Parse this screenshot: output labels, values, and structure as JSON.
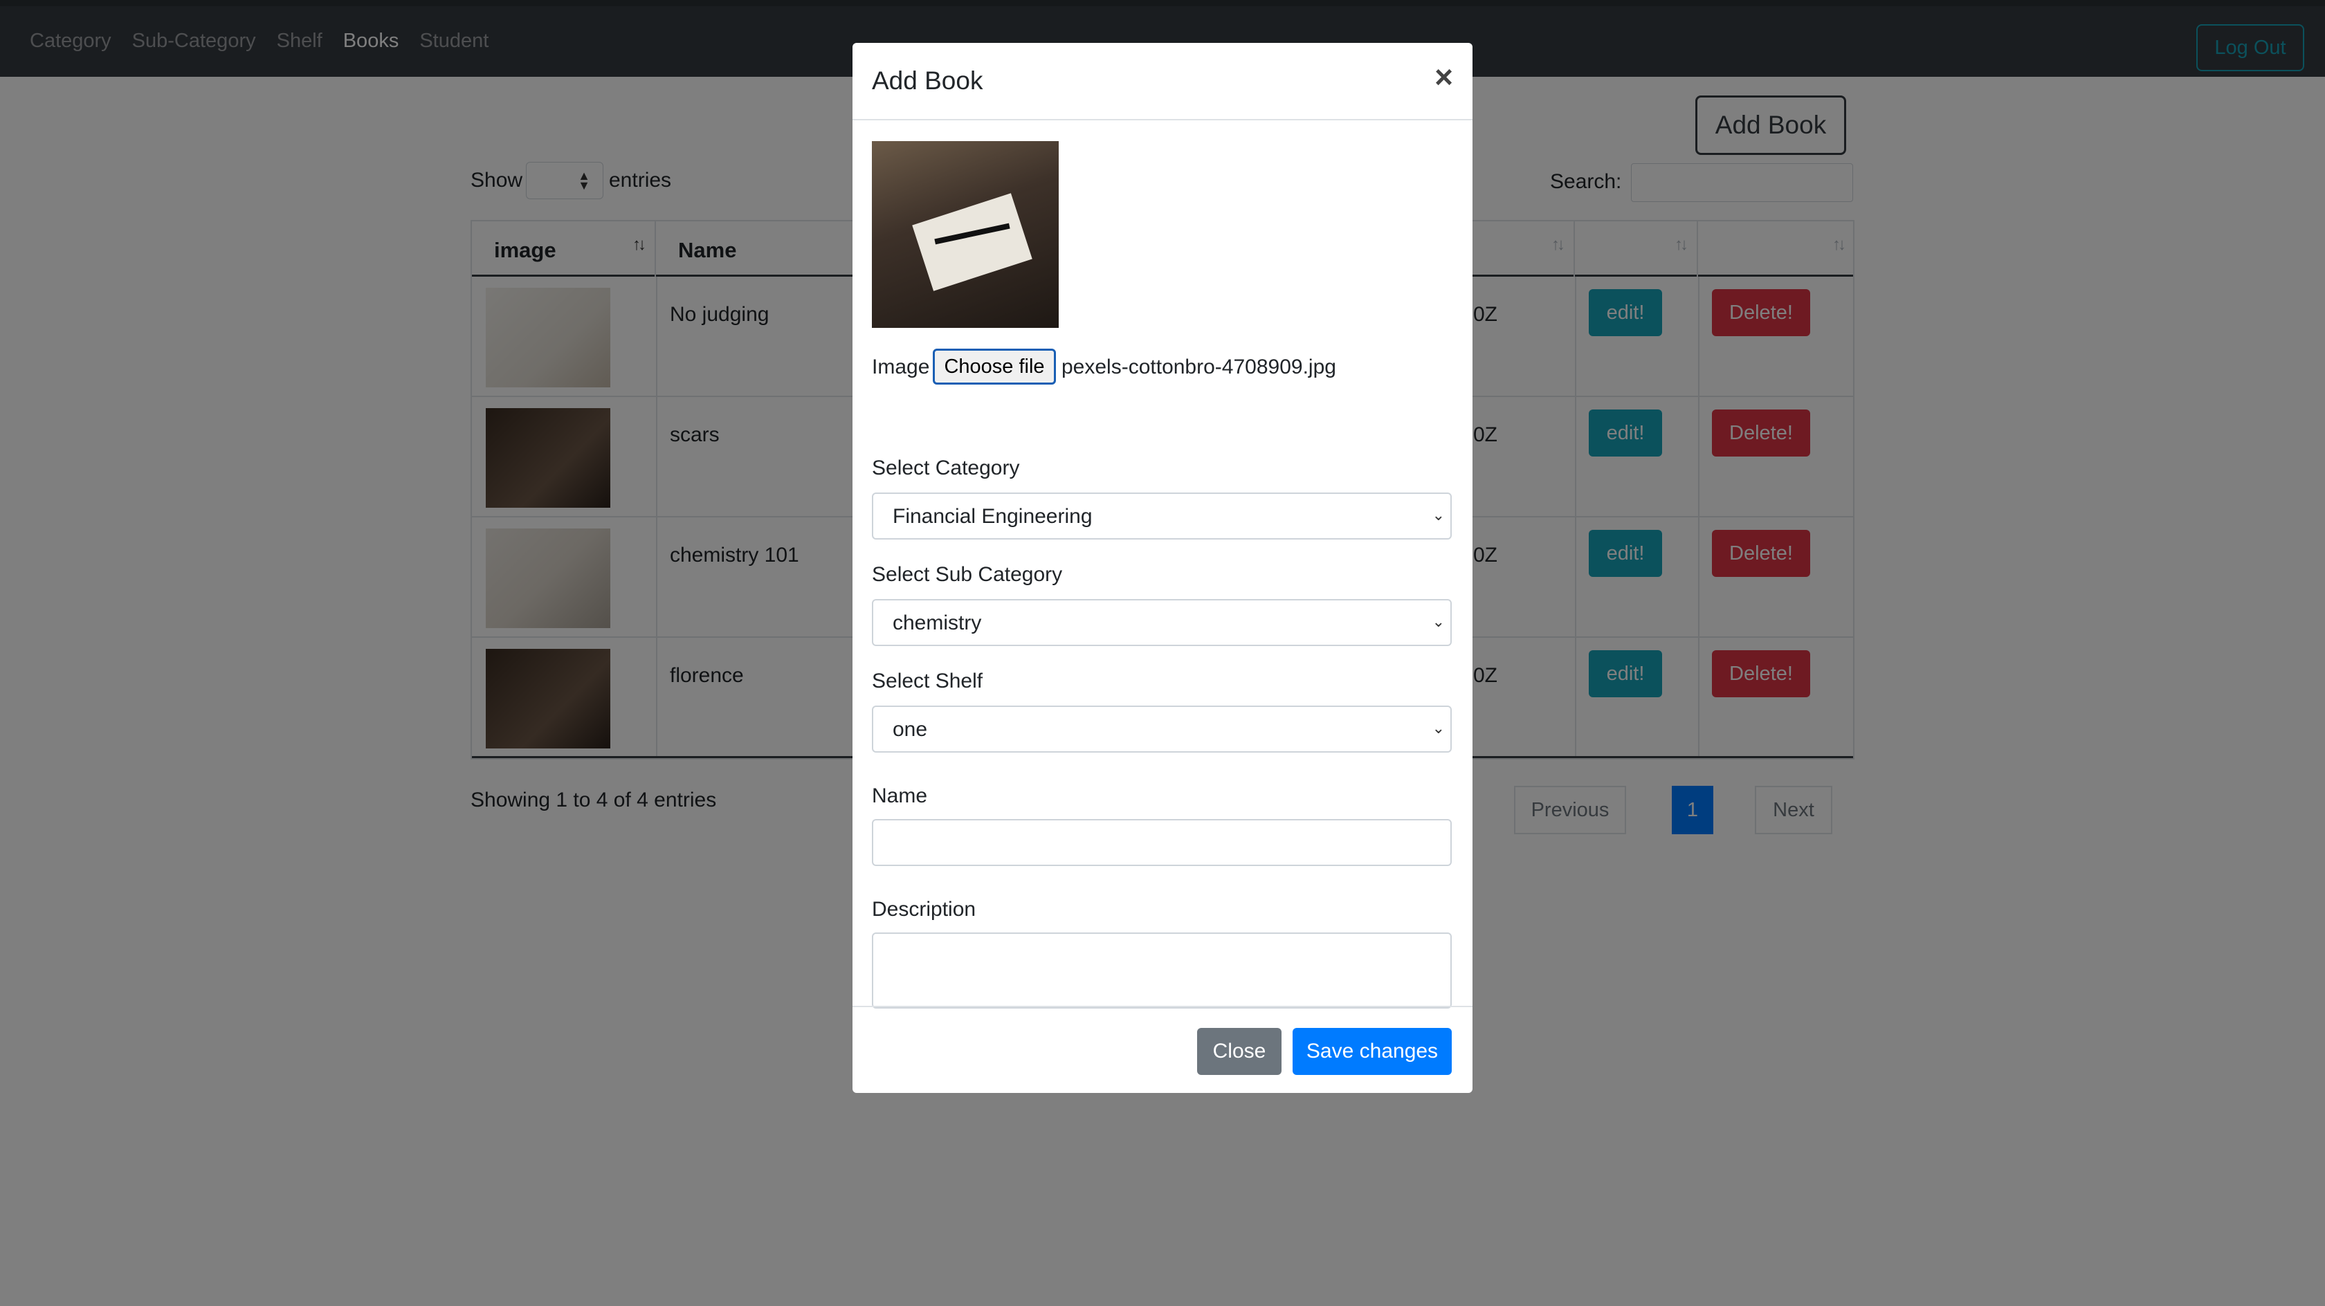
{
  "navbar": {
    "links": [
      "Category",
      "Sub-Category",
      "Shelf",
      "Books",
      "Student"
    ],
    "active": "Books",
    "logout_label": "Log Out"
  },
  "page": {
    "add_book_label": "Add Book",
    "show_label": "Show",
    "entries_label": "entries",
    "search_label": "Search:",
    "columns": [
      "image",
      "Name"
    ],
    "rows": [
      {
        "name": "No judging",
        "partial": "0Z",
        "edit": "edit!",
        "delete": "Delete!"
      },
      {
        "name": "scars",
        "partial": "0Z",
        "edit": "edit!",
        "delete": "Delete!"
      },
      {
        "name": "chemistry 101",
        "partial": "0Z",
        "edit": "edit!",
        "delete": "Delete!"
      },
      {
        "name": "florence",
        "partial": "0Z",
        "edit": "edit!",
        "delete": "Delete!"
      }
    ],
    "showing_text": "Showing 1 to 4 of 4 entries",
    "pagination": {
      "previous": "Previous",
      "current": "1",
      "next": "Next"
    }
  },
  "modal": {
    "title": "Add Book",
    "close_icon": "×",
    "image_label": "Image",
    "choose_file_label": "Choose file",
    "file_name": "pexels-cottonbro-4708909.jpg",
    "category_label": "Select Category",
    "category_value": "Financial Engineering",
    "subcategory_label": "Select Sub Category",
    "subcategory_value": "chemistry",
    "shelf_label": "Select Shelf",
    "shelf_value": "one",
    "name_label": "Name",
    "name_value": "",
    "description_label": "Description",
    "description_value": "",
    "close_button": "Close",
    "save_button": "Save changes"
  },
  "colors": {
    "navbar": "#343a40",
    "info": "#17a2b8",
    "danger": "#dc3545",
    "primary": "#007bff",
    "secondary": "#6c757d"
  }
}
